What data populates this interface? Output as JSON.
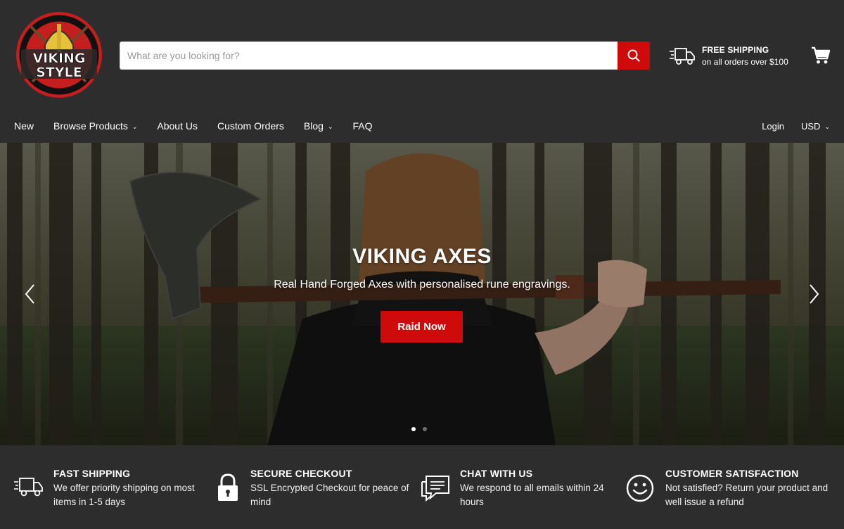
{
  "header": {
    "logo_text_top": "VIKING",
    "logo_text_bottom": "STYLE",
    "search_placeholder": "What are you looking for?",
    "shipping_title": "FREE SHIPPING",
    "shipping_sub": "on all orders over $100"
  },
  "nav": {
    "items": [
      {
        "label": "New"
      },
      {
        "label": "Browse Products"
      },
      {
        "label": "About Us"
      },
      {
        "label": "Custom Orders"
      },
      {
        "label": "Blog"
      },
      {
        "label": "FAQ"
      }
    ],
    "login": "Login",
    "currency": "USD"
  },
  "hero": {
    "title": "VIKING AXES",
    "subtitle": "Real Hand Forged Axes with personalised rune engravings.",
    "cta": "Raid Now"
  },
  "features": [
    {
      "title": "FAST SHIPPING",
      "desc": "We offer priority shipping on most items in 1-5 days",
      "icon": "truck-icon"
    },
    {
      "title": "SECURE CHECKOUT",
      "desc": "SSL Encrypted Checkout for peace of mind",
      "icon": "lock-icon"
    },
    {
      "title": "CHAT WITH US",
      "desc": "We respond to all emails within 24 hours",
      "icon": "chat-icon"
    },
    {
      "title": "CUSTOMER SATISFACTION",
      "desc": "Not satisfied? Return your product and well issue a refund",
      "icon": "smiley-icon"
    }
  ],
  "colors": {
    "background": "#2d2d2d",
    "accent": "#cf0a0a"
  }
}
